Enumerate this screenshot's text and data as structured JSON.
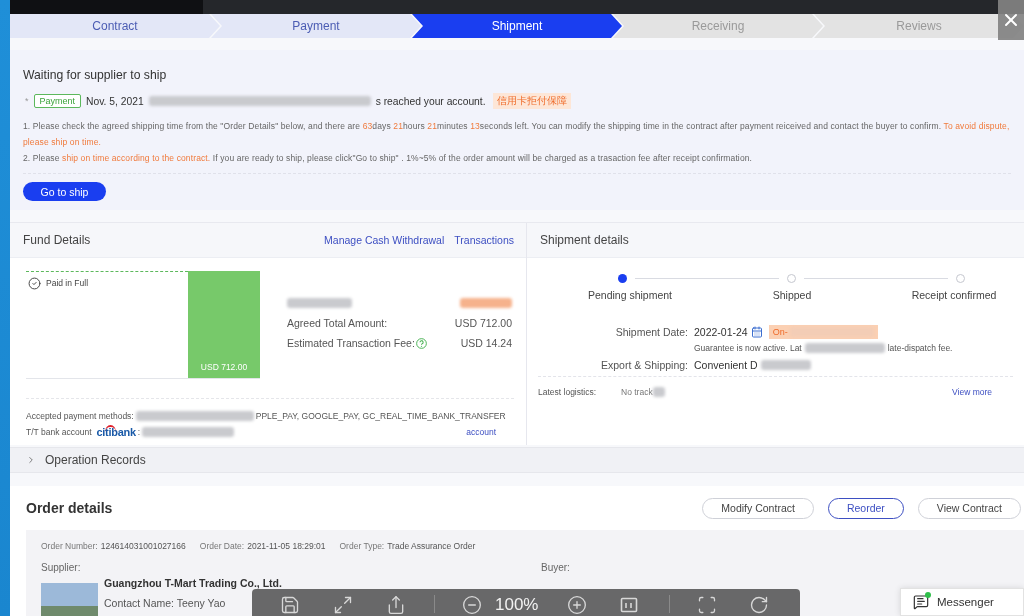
{
  "steps": [
    {
      "label": "Contract",
      "done": true,
      "current": false
    },
    {
      "label": "Payment",
      "done": true,
      "current": false
    },
    {
      "label": "Shipment",
      "done": false,
      "current": true
    },
    {
      "label": "Receiving",
      "done": false,
      "current": false
    },
    {
      "label": "Reviews",
      "done": false,
      "current": false
    }
  ],
  "notice": {
    "title": "Waiting for supplier to ship",
    "marker": "*",
    "payment_badge": "Payment",
    "date": "Nov. 5, 2021",
    "reached_text": "s reached your account.",
    "guarantee_badge": "信用卡拒付保障",
    "instructions": [
      [
        {
          "text": "1. Please check the agreed shipping time from the \"Order Details\" below, and there are ",
          "highlight": false
        },
        {
          "text": "63",
          "highlight": true
        },
        {
          "text": "days ",
          "highlight": false
        },
        {
          "text": "21",
          "highlight": true
        },
        {
          "text": "hours ",
          "highlight": false
        },
        {
          "text": "21",
          "highlight": true
        },
        {
          "text": "minutes ",
          "highlight": false
        },
        {
          "text": "13",
          "highlight": true
        },
        {
          "text": "seconds left. You can modify the shipping time in the contract after payment reiceived and contact the buyer to confirm. ",
          "highlight": false
        },
        {
          "text": "To avoid dispute, please ship on time.",
          "highlight": true
        }
      ],
      [
        {
          "text": "2. Please ",
          "highlight": false
        },
        {
          "text": "ship on time according to the contract.",
          "highlight": true
        },
        {
          "text": " If you are ready to ship, please click\"Go to ship\" . 1%~5% of the order amount will be charged as a trasaction fee after receipt confirmation.",
          "highlight": false
        }
      ]
    ],
    "button": "Go to ship"
  },
  "fund_details": {
    "title": "Fund Details",
    "links": [
      "Manage Cash Withdrawal",
      "Transactions"
    ],
    "status_label": "Paid in Full",
    "bar_label": "USD 712.00",
    "amounts": [
      {
        "label": "Agreed Total Amount:",
        "value": "USD 712.00",
        "help": false
      },
      {
        "label": "Estimated Transaction Fee:",
        "value": "USD 14.24",
        "help": true
      }
    ],
    "payment_methods_label": "Accepted payment methods:",
    "payment_methods_rest": "PPLE_PAY, GOOGLE_PAY, GC_REAL_TIME_BANK_TRANSFER",
    "bank_label": "T/T bank account",
    "bank_logo": "citibank",
    "bank_separator": ":",
    "bank_link": "account"
  },
  "shipment_details": {
    "title": "Shipment details",
    "progress": [
      {
        "label": "Pending shipment",
        "reached": true
      },
      {
        "label": "Shipped",
        "reached": false
      },
      {
        "label": "Receipt confirmed",
        "reached": false
      }
    ],
    "shipment_date_label": "Shipment Date:",
    "shipment_date": "2022-01-24",
    "date_badge": "On-",
    "note_start": "Guarantee is now active. Lat",
    "note_end": "late-dispatch fee.",
    "shipping_label": "Export & Shipping:",
    "shipping_value": "Convenient D",
    "logistics_label": "Latest logistics:",
    "logistics_value": "No track",
    "logistics_link": "View more"
  },
  "operation_records": {
    "label": "Operation Records",
    "expanded": false
  },
  "order_details": {
    "title": "Order details",
    "buttons": [
      {
        "label": "Modify Contract",
        "kind": "default"
      },
      {
        "label": "Reorder",
        "kind": "primary"
      },
      {
        "label": "View Contract",
        "kind": "default"
      }
    ],
    "meta": [
      {
        "label": "Order Number:",
        "value": "124614031001027166"
      },
      {
        "label": "Order Date:",
        "value": "2021-11-05 18:29:01"
      },
      {
        "label": "Order Type:",
        "value": "Trade Assurance Order"
      }
    ],
    "supplier_label": "Supplier:",
    "supplier_name": "Guangzhou T-Mart Trading Co., Ltd.",
    "supplier_contact": "Contact Name: Teeny Yao",
    "buyer_label": "Buyer:"
  },
  "messenger": {
    "label": "Messenger",
    "unread": true
  },
  "viewer_toolbar": {
    "zoom": "100%"
  }
}
